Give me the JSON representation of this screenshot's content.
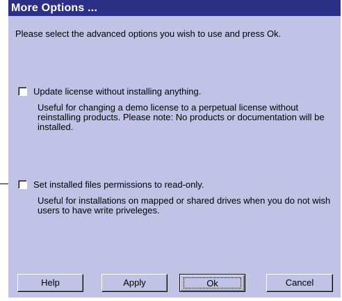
{
  "dialog": {
    "title": "More Options ...",
    "intro": "Please select the advanced options you wish to use and press Ok."
  },
  "options": [
    {
      "label": "Update license without installing anything.",
      "description": "Useful for changing a demo license to a perpetual license without reinstalling products. Please note: No products or documentation will be installed.",
      "checked": false
    },
    {
      "label": "Set installed files permissions to read-only.",
      "description": "Useful for installations on mapped or shared drives when you do not wish users to have write priveleges.",
      "checked": false
    }
  ],
  "buttons": {
    "help": "Help",
    "apply": "Apply",
    "ok": "Ok",
    "cancel": "Cancel"
  },
  "colors": {
    "titlebar": "#2b2f86",
    "background": "#c0c3e6"
  }
}
